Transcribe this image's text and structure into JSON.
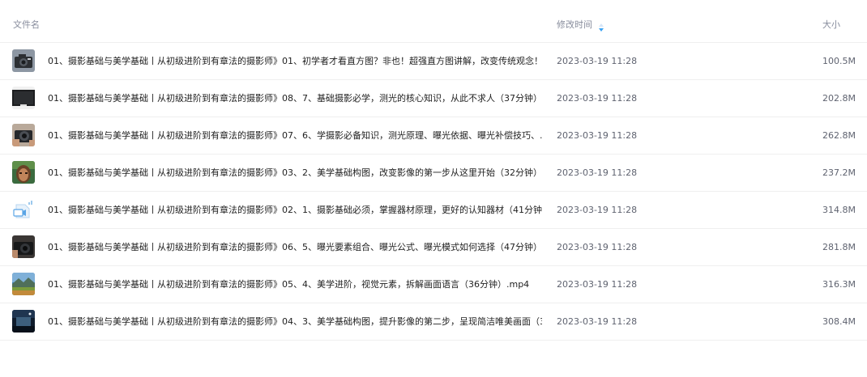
{
  "header": {
    "name_label": "文件名",
    "time_label": "修改时间",
    "size_label": "大小",
    "sort_icon": "sort-icon"
  },
  "files": [
    {
      "name": "01、摄影基础与美学基础丨从初级进阶到有章法的摄影师》01、初学者才看直方图？非也！超强直方图讲解，改变传统观念！....",
      "modified": "2023-03-19 11:28",
      "size": "100.5M",
      "thumbnail": "camera-thumbnail"
    },
    {
      "name": "01、摄影基础与美学基础丨从初级进阶到有章法的摄影师》08、7、基础摄影必学，测光的核心知识，从此不求人（37分钟）....",
      "modified": "2023-03-19 11:28",
      "size": "202.8M",
      "thumbnail": "screen-thumbnail"
    },
    {
      "name": "01、摄影基础与美学基础丨从初级进阶到有章法的摄影师》07、6、学摄影必备知识，测光原理、曝光依据、曝光补偿技巧、...",
      "modified": "2023-03-19 11:28",
      "size": "262.8M",
      "thumbnail": "camera-hand-thumbnail"
    },
    {
      "name": "01、摄影基础与美学基础丨从初级进阶到有章法的摄影师》03、2、美学基础构图，改变影像的第一步从这里开始（32分钟）....",
      "modified": "2023-03-19 11:28",
      "size": "237.2M",
      "thumbnail": "portrait-thumbnail"
    },
    {
      "name": "01、摄影基础与美学基础丨从初级进阶到有章法的摄影师》02、1、摄影基础必须，掌握器材原理，更好的认知器材（41分钟...",
      "modified": "2023-03-19 11:28",
      "size": "314.8M",
      "thumbnail": "video-file-thumbnail"
    },
    {
      "name": "01、摄影基础与美学基础丨从初级进阶到有章法的摄影师》06、5、曝光要素组合、曝光公式、曝光模式如何选择（47分钟）....",
      "modified": "2023-03-19 11:28",
      "size": "281.8M",
      "thumbnail": "camera-dark-thumbnail"
    },
    {
      "name": "01、摄影基础与美学基础丨从初级进阶到有章法的摄影师》05、4、美学进阶，视觉元素，拆解画面语言（36分钟）.mp4",
      "modified": "2023-03-19 11:28",
      "size": "316.3M",
      "thumbnail": "landscape-thumbnail"
    },
    {
      "name": "01、摄影基础与美学基础丨从初级进阶到有章法的摄影师》04、3、美学基础构图，提升影像的第二步，呈现简洁唯美画面（3...",
      "modified": "2023-03-19 11:28",
      "size": "308.4M",
      "thumbnail": "night-scene-thumbnail"
    }
  ]
}
